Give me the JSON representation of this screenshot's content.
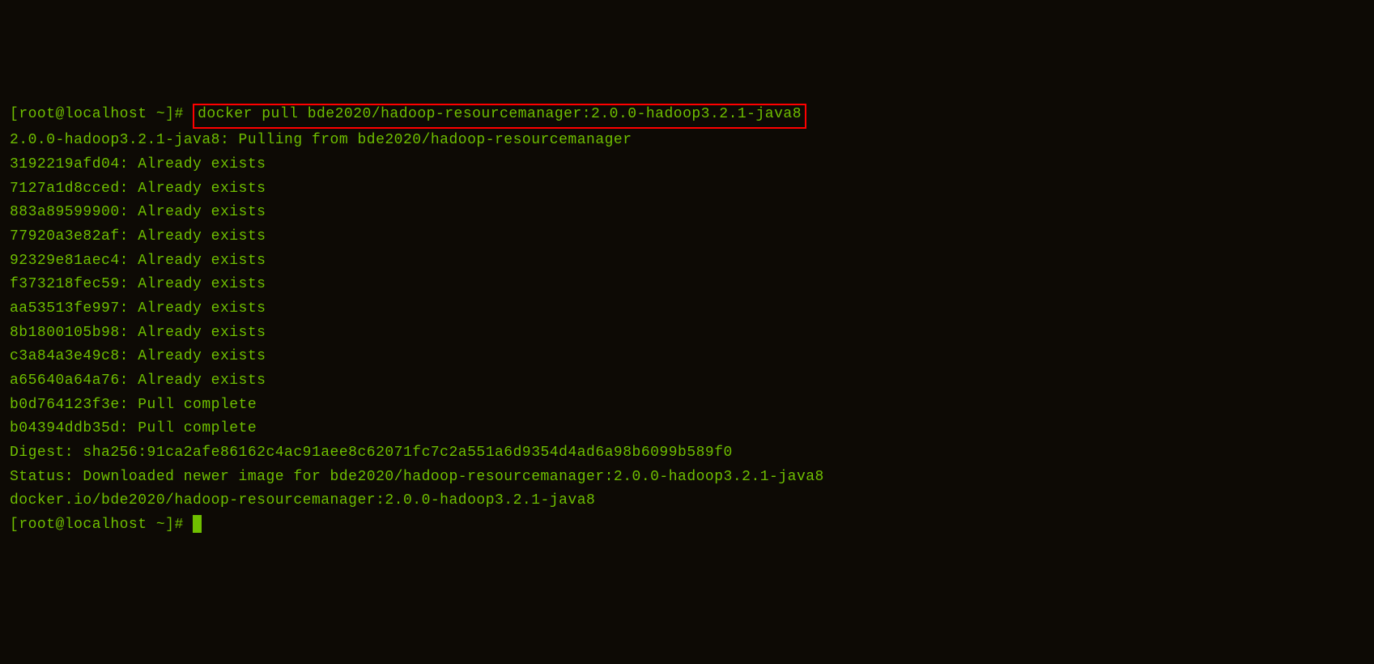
{
  "prompt1": {
    "bracket_open": "[",
    "user_host": "root@localhost",
    "path": " ~",
    "bracket_close": "]",
    "hash": "# ",
    "command": "docker pull bde2020/hadoop-resourcemanager:2.0.0-hadoop3.2.1-java8"
  },
  "lines": [
    "2.0.0-hadoop3.2.1-java8: Pulling from bde2020/hadoop-resourcemanager",
    "3192219afd04: Already exists",
    "7127a1d8cced: Already exists",
    "883a89599900: Already exists",
    "77920a3e82af: Already exists",
    "92329e81aec4: Already exists",
    "f373218fec59: Already exists",
    "aa53513fe997: Already exists",
    "8b1800105b98: Already exists",
    "c3a84a3e49c8: Already exists",
    "a65640a64a76: Already exists",
    "b0d764123f3e: Pull complete",
    "b04394ddb35d: Pull complete",
    "Digest: sha256:91ca2afe86162c4ac91aee8c62071fc7c2a551a6d9354d4ad6a98b6099b589f0",
    "Status: Downloaded newer image for bde2020/hadoop-resourcemanager:2.0.0-hadoop3.2.1-java8",
    "docker.io/bde2020/hadoop-resourcemanager:2.0.0-hadoop3.2.1-java8"
  ],
  "prompt2": {
    "bracket_open": "[",
    "user_host": "root@localhost",
    "path": " ~",
    "bracket_close": "]",
    "hash": "# "
  }
}
